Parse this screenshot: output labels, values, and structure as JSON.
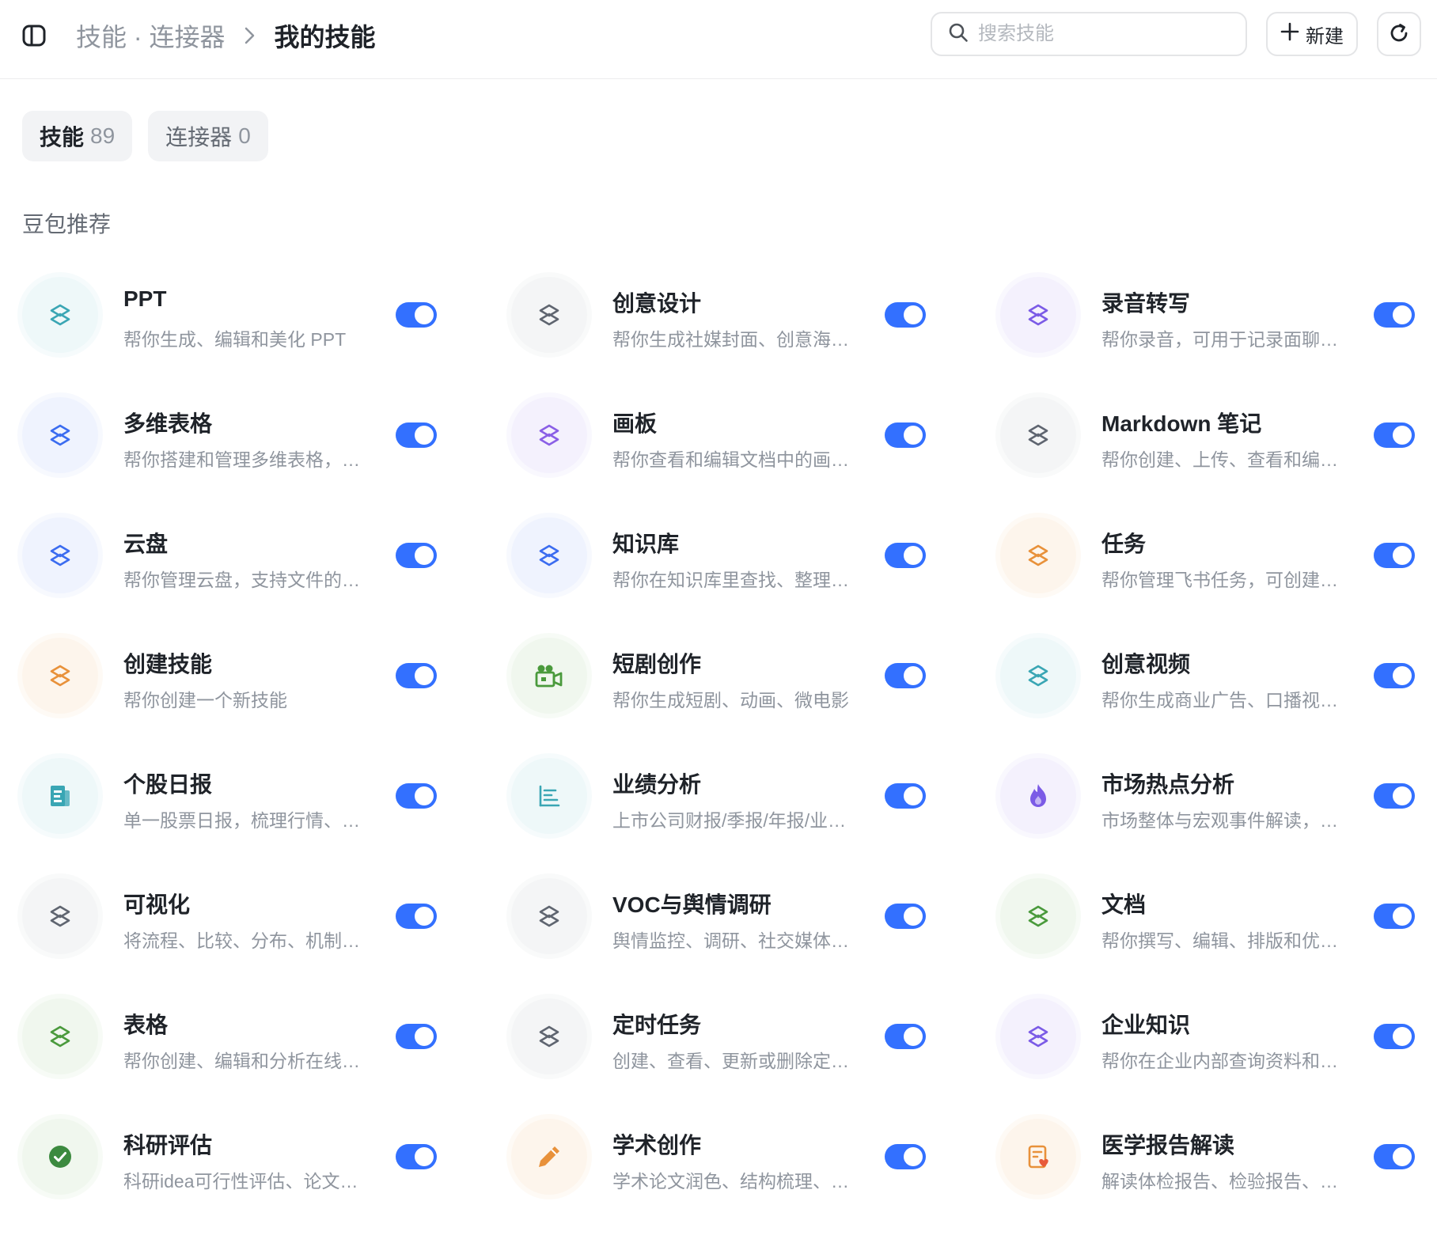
{
  "header": {
    "breadcrumb_parent": "技能 · 连接器",
    "breadcrumb_current": "我的技能",
    "search_placeholder": "搜索技能",
    "new_label": "新建"
  },
  "tabs": [
    {
      "label": "技能",
      "count": "89",
      "active": true
    },
    {
      "label": "连接器",
      "count": "0",
      "active": false
    }
  ],
  "section": {
    "title": "豆包推荐"
  },
  "skills": [
    {
      "name": "PPT",
      "desc": "帮你生成、编辑和美化 PPT",
      "icon": "layers-icon",
      "color": "#3aa6b4",
      "bg": "#eef8f9",
      "enabled": true
    },
    {
      "name": "创意设计",
      "desc": "帮你生成社媒封面、创意海报等设计作品",
      "icon": "layers-icon",
      "color": "#5f6570",
      "bg": "#f4f5f6",
      "enabled": true
    },
    {
      "name": "录音转写",
      "desc": "帮你录音，可用于记录面聊和会议内容",
      "icon": "layers-icon",
      "color": "#7b5be6",
      "bg": "#f4f1fd",
      "enabled": true
    },
    {
      "name": "多维表格",
      "desc": "帮你搭建和管理多维表格，处理数据",
      "icon": "layers-icon",
      "color": "#3b6cf0",
      "bg": "#eff3fe",
      "enabled": true
    },
    {
      "name": "画板",
      "desc": "帮你查看和编辑文档中的画板内容",
      "icon": "layers-icon",
      "color": "#8a5fe6",
      "bg": "#f4f1fd",
      "enabled": true
    },
    {
      "name": "Markdown 笔记",
      "desc": "帮你创建、上传、查看和编辑笔记",
      "icon": "layers-icon",
      "color": "#5f6570",
      "bg": "#f4f5f6",
      "enabled": true
    },
    {
      "name": "云盘",
      "desc": "帮你管理云盘，支持文件的上传和下载",
      "icon": "layers-icon",
      "color": "#3b6cf0",
      "bg": "#eff3fe",
      "enabled": true
    },
    {
      "name": "知识库",
      "desc": "帮你在知识库里查找、整理和归档",
      "icon": "layers-icon",
      "color": "#3b6cf0",
      "bg": "#eff3fe",
      "enabled": true
    },
    {
      "name": "任务",
      "desc": "帮你管理飞书任务，可创建和更新任务",
      "icon": "layers-icon",
      "color": "#e8913a",
      "bg": "#fdf5ec",
      "enabled": true
    },
    {
      "name": "创建技能",
      "desc": "帮你创建一个新技能",
      "icon": "layers-icon",
      "color": "#e8913a",
      "bg": "#fdf5ec",
      "enabled": true
    },
    {
      "name": "短剧创作",
      "desc": "帮你生成短剧、动画、微电影",
      "icon": "video-camera-icon",
      "color": "#4a9a3c",
      "bg": "#f0f7ee",
      "enabled": true
    },
    {
      "name": "创意视频",
      "desc": "帮你生成商业广告、口播视频等内容",
      "icon": "layers-icon",
      "color": "#3aa6b4",
      "bg": "#eef8f9",
      "enabled": true
    },
    {
      "name": "个股日报",
      "desc": "单一股票日报，梳理行情、资讯与观点",
      "icon": "report-icon",
      "color": "#3aa6b4",
      "bg": "#eef8f9",
      "enabled": true
    },
    {
      "name": "业绩分析",
      "desc": "上市公司财报/季报/年报/业绩分析",
      "icon": "bar-list-icon",
      "color": "#3aa6b4",
      "bg": "#eef8f9",
      "enabled": true
    },
    {
      "name": "市场热点分析",
      "desc": "市场整体与宏观事件解读，追踪热点",
      "icon": "flame-icon",
      "color": "#7b5be6",
      "bg": "#f4f1fd",
      "enabled": true
    },
    {
      "name": "可视化",
      "desc": "将流程、比较、分布、机制等可视化",
      "icon": "layers-icon",
      "color": "#5f6570",
      "bg": "#f4f5f6",
      "enabled": true
    },
    {
      "name": "VOC与舆情调研",
      "desc": "舆情监控、调研、社交媒体分析",
      "icon": "layers-icon",
      "color": "#5f6570",
      "bg": "#f4f5f6",
      "enabled": true
    },
    {
      "name": "文档",
      "desc": "帮你撰写、编辑、排版和优化文档",
      "icon": "layers-icon",
      "color": "#4a9a3c",
      "bg": "#f0f7ee",
      "enabled": true
    },
    {
      "name": "表格",
      "desc": "帮你创建、编辑和分析在线表格",
      "icon": "layers-icon",
      "color": "#4a9a3c",
      "bg": "#f0f7ee",
      "enabled": true
    },
    {
      "name": "定时任务",
      "desc": "创建、查看、更新或删除定时任务",
      "icon": "layers-icon",
      "color": "#5f6570",
      "bg": "#f4f5f6",
      "enabled": true
    },
    {
      "name": "企业知识",
      "desc": "帮你在企业内部查询资料和知识",
      "icon": "layers-icon",
      "color": "#7b5be6",
      "bg": "#f4f1fd",
      "enabled": true
    },
    {
      "name": "科研评估",
      "desc": "科研idea可行性评估、论文评审",
      "icon": "check-circle-icon",
      "color": "#3c8a3f",
      "bg": "#f0f7ee",
      "enabled": true
    },
    {
      "name": "学术创作",
      "desc": "学术论文润色、结构梳理、写作辅助",
      "icon": "pencil-icon",
      "color": "#e8913a",
      "bg": "#fdf5ec",
      "enabled": true
    },
    {
      "name": "医学报告解读",
      "desc": "解读体检报告、检验报告、影像报告",
      "icon": "medical-report-icon",
      "color": "#e8913a",
      "bg": "#fdf5ec",
      "enabled": true
    }
  ]
}
